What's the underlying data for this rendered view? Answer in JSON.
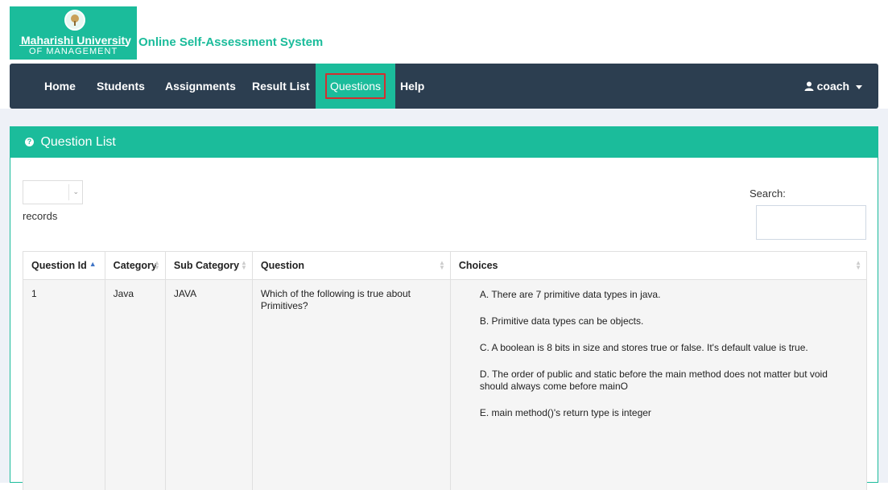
{
  "header": {
    "logo_line1": "Maharishi University",
    "logo_line2": "OF MANAGEMENT",
    "app_title": "Online Self-Assessment System"
  },
  "nav": {
    "items": [
      {
        "label": "Home"
      },
      {
        "label": "Students"
      },
      {
        "label": "Assignments"
      },
      {
        "label": "Result List"
      },
      {
        "label": "Questions",
        "active": true
      },
      {
        "label": "Help"
      }
    ],
    "user": "coach"
  },
  "panel": {
    "title": "Question List",
    "length_select_value": "",
    "records_label": "records",
    "search_label": "Search:",
    "search_value": ""
  },
  "table": {
    "columns": [
      "Question Id",
      "Category",
      "Sub Category",
      "Question",
      "Choices"
    ],
    "rows": [
      {
        "id": "1",
        "category": "Java",
        "subcategory": "JAVA",
        "question": "Which of the following is true about Primitives?",
        "choices": [
          "A. There are 7 primitive data types in java.",
          "B. Primitive data types can be objects.",
          "C. A boolean is 8 bits in size and stores true or false. It's default value is true.",
          "D. The order of public and static before the main method does not matter but void should always come before mainO",
          "E. main method()'s return type is integer"
        ]
      }
    ]
  },
  "colors": {
    "accent": "#1bbc9b",
    "navbar": "#2c3e50",
    "highlight_box": "#d32f2f"
  }
}
